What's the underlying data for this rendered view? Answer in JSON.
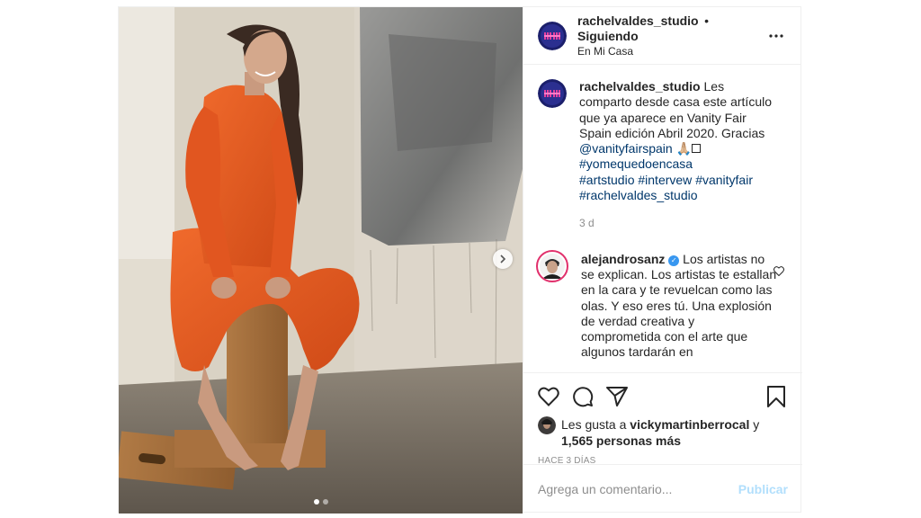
{
  "post": {
    "author": {
      "username": "rachelvaldes_studio",
      "separator": "•",
      "follow_status": "Siguiendo",
      "location": "En Mi Casa",
      "avatar_icon": "studio-logo-avatar"
    },
    "caption": {
      "username": "rachelvaldes_studio",
      "text": "Les comparto desde casa este artículo que ya aparece en Vanity Fair Spain edición Abril 2020. Gracias",
      "mention": "@vanityfairspain",
      "emoji": "🙏🏼",
      "hashtags": [
        "#yomequedoencasa",
        "#artstudio",
        "#intervew",
        "#vanityfair",
        "#rachelvaldes_studio"
      ],
      "time": "3 d"
    },
    "comments": [
      {
        "username": "alejandrosanz",
        "verified": true,
        "text": "Los artistas no se explican. Los artistas te estallan en la cara y te revuelcan como las olas. Y eso eres tú. Una explosión de verdad creativa y comprometida con el arte que algunos tardarán en"
      }
    ],
    "likes": {
      "prefix": "Les gusta a",
      "user": "vickymartinberrocal",
      "conjunction": "y",
      "count_text": "1,565 personas más"
    },
    "posted_ago": "HACE 3 DÍAS",
    "add_comment": {
      "placeholder": "Agrega un comentario...",
      "publish_label": "Publicar"
    },
    "carousel": {
      "current": 1,
      "total": 2
    },
    "colors": {
      "link": "#00376b",
      "muted": "#8e8e8e",
      "publish_disabled": "#b2dffc",
      "verified": "#3897f0",
      "suit_orange": "#e2551f"
    }
  }
}
